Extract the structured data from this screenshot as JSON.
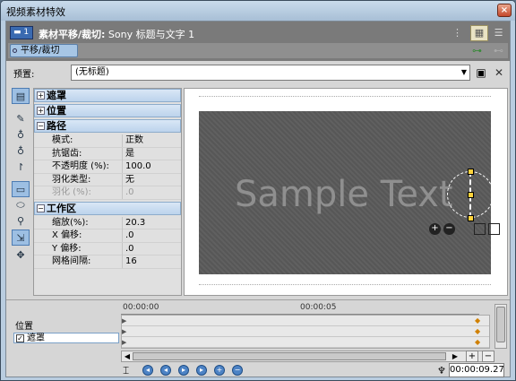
{
  "window": {
    "title": "视频素材特效",
    "close_label": "×"
  },
  "fx_header": {
    "badge": "1",
    "name": "素材平移/裁切:",
    "subtitle": "Sony 标题与文字 1",
    "chain_item": "平移/裁切"
  },
  "preset": {
    "label": "预置:",
    "value": "(无标题)"
  },
  "props": {
    "sections": {
      "mask": "遮罩",
      "position": "位置",
      "path": "路径",
      "workspace": "工作区"
    },
    "path_rows": [
      {
        "label": "模式:",
        "value": "正数"
      },
      {
        "label": "抗锯齿:",
        "value": "是"
      },
      {
        "label": "不透明度 (%):",
        "value": "100.0"
      },
      {
        "label": "羽化类型:",
        "value": "无"
      },
      {
        "label": "羽化 (%):",
        "value": ".0"
      }
    ],
    "workspace_rows": [
      {
        "label": "缩放(%):",
        "value": "20.3"
      },
      {
        "label": "X 偏移:",
        "value": ".0"
      },
      {
        "label": "Y 偏移:",
        "value": ".0"
      },
      {
        "label": "网格间隔:",
        "value": "16"
      }
    ]
  },
  "preview": {
    "sample_text": "Sample Text"
  },
  "timeline": {
    "tracks": [
      "位置",
      "遮罩"
    ],
    "ruler": [
      "00:00:00",
      "00:00:05"
    ],
    "timecode": "00:00:09.27"
  }
}
